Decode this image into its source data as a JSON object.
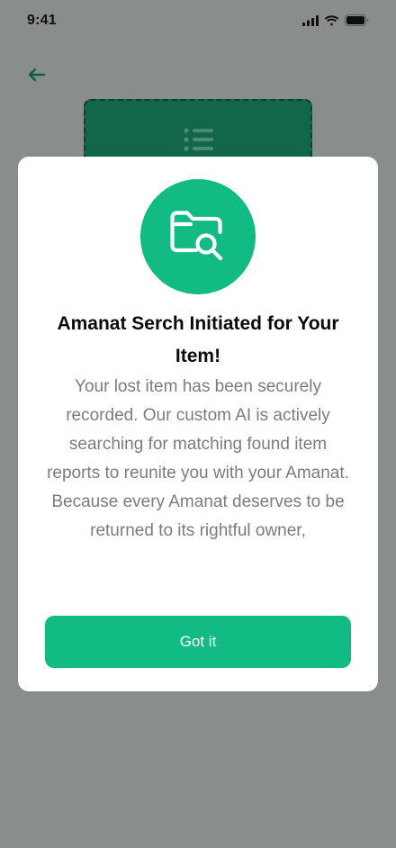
{
  "status_bar": {
    "time": "9:41",
    "icons": [
      "cellular-signal-icon",
      "wifi-icon",
      "battery-icon"
    ]
  },
  "header": {
    "back_icon": "arrow-left-icon"
  },
  "background_card": {
    "icon": "list-icon"
  },
  "modal": {
    "icon": "folder-search-icon",
    "title": "Amanat Serch Initiated for Your Item!",
    "message": "Your lost item has been securely recorded. Our custom AI is actively searching for matching found item reports to reunite you with your Amanat. Because every Amanat deserves to be returned to its rightful owner,",
    "button_label": "Got it"
  },
  "colors": {
    "accent": "#12bb84",
    "dark_green": "#12664a",
    "overlay": "#8a8d8d",
    "message_text": "#7c7c7c"
  }
}
